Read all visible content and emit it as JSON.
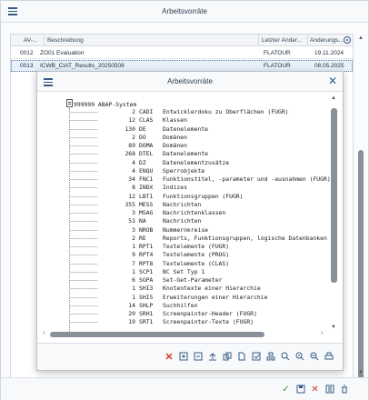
{
  "outer": {
    "title": "Arbeitsvorräte",
    "columns": [
      "AV-...",
      "Beschreibung",
      "Letzter Änder...",
      "Änderungs..."
    ],
    "rows": [
      {
        "id": "0012",
        "description": "ZO01 Evaluation",
        "changed_by": "FLATOUR",
        "changed_on": "19.11.2024"
      },
      {
        "id": "0013",
        "description": "ICWB_CIAT_Results_20250508",
        "changed_by": "FLATOUR",
        "changed_on": "08.05.2025"
      }
    ]
  },
  "inner": {
    "title": "Arbeitsvorräte",
    "root": "999999 ABAP-System",
    "items": [
      {
        "count": "2",
        "obj": "CADI",
        "text": "Entwicklerdoku zu Oberflächen (FUGR)"
      },
      {
        "count": "12",
        "obj": "CLAS",
        "text": "Klassen"
      },
      {
        "count": "130",
        "obj": "DE",
        "text": "Datenelemente"
      },
      {
        "count": "2",
        "obj": "DO",
        "text": "Domänen"
      },
      {
        "count": "89",
        "obj": "DOMA",
        "text": "Domänen"
      },
      {
        "count": "268",
        "obj": "DTEL",
        "text": "Datenelemente"
      },
      {
        "count": "4",
        "obj": "DZ",
        "text": "Datenelementzusätze"
      },
      {
        "count": "4",
        "obj": "ENQU",
        "text": "Sperrobjekte"
      },
      {
        "count": "34",
        "obj": "FNC1",
        "text": "Funktionstitel, -parameter und -ausnahmen (FUGR)"
      },
      {
        "count": "8",
        "obj": "INDX",
        "text": "Indizes"
      },
      {
        "count": "12",
        "obj": "LBT1",
        "text": "Funktionsgruppen (FUGR)"
      },
      {
        "count": "355",
        "obj": "MESS",
        "text": "Nachrichten"
      },
      {
        "count": "3",
        "obj": "MSAG",
        "text": "Nachrichtenklassen"
      },
      {
        "count": "51",
        "obj": "NA",
        "text": "Nachrichten"
      },
      {
        "count": "3",
        "obj": "NROB",
        "text": "Nummernkreise"
      },
      {
        "count": "2",
        "obj": "RE",
        "text": "Reports, Funktionsgruppen, logische Datenbanken"
      },
      {
        "count": "1",
        "obj": "RPT1",
        "text": "Textelemente (FUGR)"
      },
      {
        "count": "9",
        "obj": "RPT4",
        "text": "Textelemente (PROG)"
      },
      {
        "count": "7",
        "obj": "RPT8",
        "text": "Textelemente (CLAS)"
      },
      {
        "count": "1",
        "obj": "SCP1",
        "text": "BC Set Typ 1"
      },
      {
        "count": "6",
        "obj": "SGPA",
        "text": "Set-Get-Parameter"
      },
      {
        "count": "1",
        "obj": "SHI3",
        "text": "Knotentexte einer Hierarchie"
      },
      {
        "count": "1",
        "obj": "SHI5",
        "text": "Erweiterungen einer Hierarchie"
      },
      {
        "count": "14",
        "obj": "SHLP",
        "text": "Suchhilfen"
      },
      {
        "count": "20",
        "obj": "SRH1",
        "text": "Screenpainter-Header (FUGR)"
      },
      {
        "count": "19",
        "obj": "SRT1",
        "text": "Screenpainter-Texte (FUGR)"
      }
    ]
  },
  "icons": {
    "outer_menu": "hamburger-menu-icon",
    "inner_menu": "hamburger-menu-icon",
    "inner_close": "close-icon",
    "settings": "table-settings-icon",
    "inner_toolbar": [
      "delete-icon",
      "expand-icon",
      "collapse-icon",
      "upload-icon",
      "copy-icon",
      "document-icon",
      "select-icon",
      "hierarchy-icon",
      "find-icon",
      "find-next-icon",
      "zoom-out-icon",
      "print-icon"
    ],
    "outer_footer": [
      "confirm-icon",
      "save-icon",
      "cancel-icon",
      "select-all-icon",
      "delete-icon"
    ]
  },
  "colors": {
    "accent": "#345a85",
    "cancel": "#d23b2e",
    "confirm": "#2f8c3a",
    "selection": "#e8f1fb"
  }
}
